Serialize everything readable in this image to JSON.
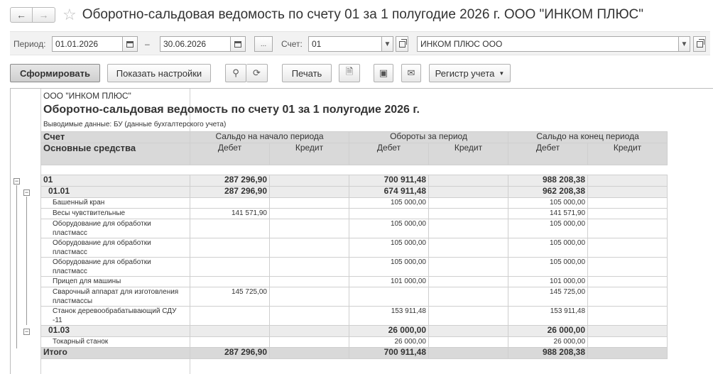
{
  "window": {
    "title": "Оборотно-сальдовая ведомость по счету 01 за 1 полугодие 2026 г. ООО \"ИНКОМ ПЛЮС\""
  },
  "filters": {
    "period_label": "Период:",
    "date_from": "01.01.2026",
    "dash": "–",
    "date_to": "30.06.2026",
    "more_btn": "...",
    "account_label": "Счет:",
    "account_value": "01",
    "org_value": "ИНКОМ ПЛЮС ООО"
  },
  "toolbar": {
    "generate": "Сформировать",
    "show_settings": "Показать настройки",
    "print": "Печать",
    "register": "Регистр учета"
  },
  "report": {
    "org": "ООО \"ИНКОМ ПЛЮС\"",
    "title": "Оборотно-сальдовая ведомость по счету 01 за 1 полугодие 2026 г.",
    "output": "Выводимые данные: БУ (данные бухгалтерского учета)",
    "col_account": "Счет",
    "col_sub": "Основные средства",
    "col_open": "Сальдо на начало периода",
    "col_turn": "Обороты за период",
    "col_close": "Сальдо на конец периода",
    "debit": "Дебет",
    "credit": "Кредит",
    "rows": [
      {
        "kind": "grp",
        "level": 0,
        "name": "01",
        "od": "287 296,90",
        "oc": "",
        "td": "700 911,48",
        "tc": "",
        "cd": "988 208,38",
        "cc": ""
      },
      {
        "kind": "grp",
        "level": 1,
        "name": "01.01",
        "od": "287 296,90",
        "oc": "",
        "td": "674 911,48",
        "tc": "",
        "cd": "962 208,38",
        "cc": ""
      },
      {
        "kind": "item",
        "level": 2,
        "name": "Башенный кран",
        "od": "",
        "oc": "",
        "td": "105 000,00",
        "tc": "",
        "cd": "105 000,00",
        "cc": ""
      },
      {
        "kind": "item",
        "level": 2,
        "name": "Весы чувствительные",
        "od": "141 571,90",
        "oc": "",
        "td": "",
        "tc": "",
        "cd": "141 571,90",
        "cc": ""
      },
      {
        "kind": "item",
        "level": 2,
        "name": "Оборудование для обработки пластмасс",
        "od": "",
        "oc": "",
        "td": "105 000,00",
        "tc": "",
        "cd": "105 000,00",
        "cc": ""
      },
      {
        "kind": "item",
        "level": 2,
        "name": "Оборудование для обработки пластмасс",
        "od": "",
        "oc": "",
        "td": "105 000,00",
        "tc": "",
        "cd": "105 000,00",
        "cc": ""
      },
      {
        "kind": "item",
        "level": 2,
        "name": "Оборудование для обработки пластмасс",
        "od": "",
        "oc": "",
        "td": "105 000,00",
        "tc": "",
        "cd": "105 000,00",
        "cc": ""
      },
      {
        "kind": "item",
        "level": 2,
        "name": "Прицеп для машины",
        "od": "",
        "oc": "",
        "td": "101 000,00",
        "tc": "",
        "cd": "101 000,00",
        "cc": ""
      },
      {
        "kind": "item",
        "level": 2,
        "name": "Сварочный аппарат для изготовления пластмассы",
        "od": "145 725,00",
        "oc": "",
        "td": "",
        "tc": "",
        "cd": "145 725,00",
        "cc": ""
      },
      {
        "kind": "item",
        "level": 2,
        "name": "Станок деревообрабатывающий СДУ -11",
        "od": "",
        "oc": "",
        "td": "153 911,48",
        "tc": "",
        "cd": "153 911,48",
        "cc": ""
      },
      {
        "kind": "grp",
        "level": 1,
        "name": "01.03",
        "od": "",
        "oc": "",
        "td": "26 000,00",
        "tc": "",
        "cd": "26 000,00",
        "cc": ""
      },
      {
        "kind": "item",
        "level": 2,
        "name": "Токарный станок",
        "od": "",
        "oc": "",
        "td": "26 000,00",
        "tc": "",
        "cd": "26 000,00",
        "cc": ""
      },
      {
        "kind": "total",
        "level": 0,
        "name": "Итого",
        "od": "287 296,90",
        "oc": "",
        "td": "700 911,48",
        "tc": "",
        "cd": "988 208,38",
        "cc": ""
      }
    ]
  }
}
